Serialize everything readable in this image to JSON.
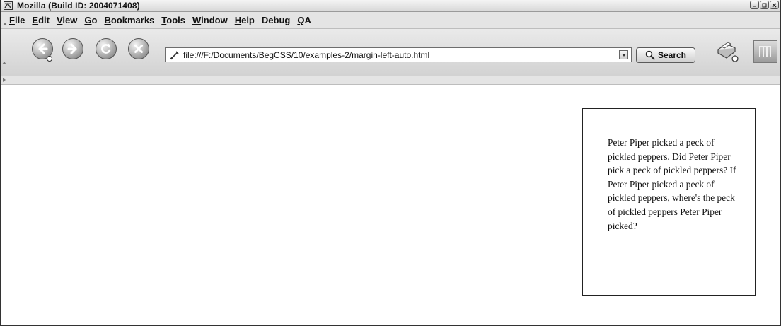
{
  "window": {
    "title": "Mozilla (Build ID: 2004071408)",
    "controls": [
      "minimize",
      "maximize",
      "close"
    ]
  },
  "menu": {
    "items": [
      {
        "label_ul": "F",
        "label_rest": "ile"
      },
      {
        "label_ul": "E",
        "label_rest": "dit"
      },
      {
        "label_ul": "V",
        "label_rest": "iew"
      },
      {
        "label_ul": "G",
        "label_rest": "o"
      },
      {
        "label_ul": "B",
        "label_rest": "ookmarks"
      },
      {
        "label_ul": "T",
        "label_rest": "ools"
      },
      {
        "label_ul": "W",
        "label_rest": "indow"
      },
      {
        "label_ul": "H",
        "label_rest": "elp"
      },
      {
        "label_pre": "Debu",
        "label_ul": "g",
        "label_rest": ""
      },
      {
        "label_ul": "Q",
        "label_rest": "A"
      }
    ]
  },
  "toolbar": {
    "back_icon": "back-arrow-icon",
    "forward_icon": "forward-arrow-icon",
    "reload_icon": "reload-icon",
    "stop_icon": "stop-icon",
    "url": "file:///F:/Documents/BegCSS/10/examples-2/margin-left-auto.html",
    "search_label": "Search",
    "print_icon": "print-icon",
    "throbber_icon": "mozilla-m-logo"
  },
  "content": {
    "paragraph": "Peter Piper picked a peck of pickled peppers. Did Peter Piper pick a peck of pickled peppers? If Peter Piper picked a peck of pickled peppers, where's the peck of pickled peppers Peter Piper picked?"
  },
  "colors": {
    "chrome": "#e4e4e4",
    "page_background": "#ffffff",
    "box_border": "#222222"
  }
}
